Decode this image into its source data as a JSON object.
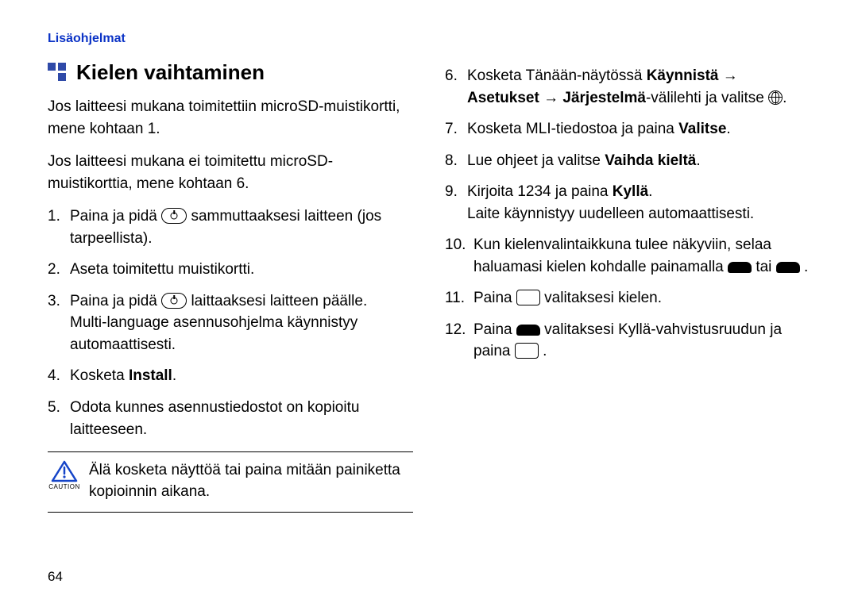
{
  "header": {
    "section_link": "Lisäohjelmat"
  },
  "title": "Kielen vaihtaminen",
  "intro1": "Jos laitteesi mukana toimitettiin microSD-muistikortti, mene kohtaan 1.",
  "intro2": "Jos laitteesi mukana ei toimitettu microSD-muistikorttia, mene kohtaan 6.",
  "left_steps": {
    "s1": {
      "num": "1.",
      "a": "Paina ja pidä ",
      "b": " sammuttaaksesi laitteen (jos tarpeellista)."
    },
    "s2": {
      "num": "2.",
      "text": "Aseta toimitettu muistikortti."
    },
    "s3": {
      "num": "3.",
      "a": "Paina ja pidä ",
      "b": " laittaaksesi laitteen päälle.",
      "c": "Multi-language asennusohjelma käynnistyy automaattisesti."
    },
    "s4": {
      "num": "4.",
      "a": "Kosketa ",
      "bold": "Install",
      "b": "."
    },
    "s5": {
      "num": "5.",
      "text": "Odota kunnes asennustiedostot on kopioitu laitteeseen."
    }
  },
  "caution": {
    "label": "CAUTION",
    "text": "Älä kosketa näyttöä tai paina mitään painiketta kopioinnin aikana."
  },
  "right_steps": {
    "s6": {
      "num": "6.",
      "a": "Kosketa Tänään-näytössä ",
      "b1": "Käynnistä",
      "arrow1": " → ",
      "b2": "Asetukset",
      "arrow2": " → ",
      "b3": "Järjestelmä",
      "c": "-välilehti ja valitse ",
      "d": "."
    },
    "s7": {
      "num": "7.",
      "a": "Kosketa MLI-tiedostoa ja paina ",
      "bold": "Valitse",
      "b": "."
    },
    "s8": {
      "num": "8.",
      "a": "Lue ohjeet ja valitse ",
      "bold": "Vaihda kieltä",
      "b": "."
    },
    "s9": {
      "num": "9.",
      "a": "Kirjoita 1234 ja paina ",
      "bold": "Kyllä",
      "b": ".",
      "c": "Laite käynnistyy uudelleen automaattisesti."
    },
    "s10": {
      "num": "10.",
      "a": "Kun kielenvalintaikkuna tulee näkyviin, selaa haluamasi kielen kohdalle painamalla ",
      "mid": " tai ",
      "end": "."
    },
    "s11": {
      "num": "11.",
      "a": "Paina ",
      "b": " valitaksesi kielen."
    },
    "s12": {
      "num": "12.",
      "a": "Paina ",
      "b": " valitaksesi Kyllä-vahvistusruudun ja paina ",
      "c": "."
    }
  },
  "page_number": "64"
}
